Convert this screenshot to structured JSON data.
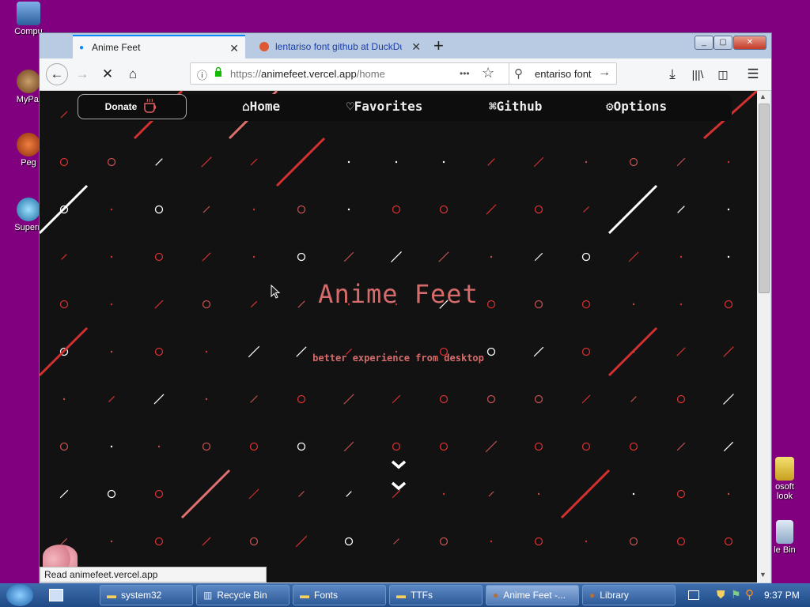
{
  "desktop": {
    "icons": [
      {
        "label": "Compu",
        "icon": "computer-icon"
      },
      {
        "label": "MyPal",
        "icon": "mypal-icon"
      },
      {
        "label": "Peg",
        "icon": "pegasus-icon"
      },
      {
        "label": "Supern",
        "icon": "supermium-icon"
      },
      {
        "label": "osoft\nlook",
        "icon": "outlook-icon"
      },
      {
        "label": "le Bin",
        "icon": "recycle-bin-icon"
      }
    ]
  },
  "browser": {
    "tabs": [
      {
        "title": "Anime Feet",
        "active": true
      },
      {
        "title": "lentariso font github at DuckDu",
        "active": false
      }
    ],
    "new_tab": "+",
    "url_protocol": "https://",
    "url_host": "animefeet.vercel.app",
    "url_path": "/home",
    "url_more": "•••",
    "search_value": "entariso font",
    "status_text": "Read animefeet.vercel.app"
  },
  "page": {
    "nav": {
      "donate": "Donate",
      "home": "Home",
      "favorites": "Favorites",
      "github": "Github",
      "options": "Options"
    },
    "title": "Anime Feet",
    "subtitle": "better experience from desktop"
  },
  "taskbar": {
    "items": [
      {
        "label": "system32",
        "icon": "folder-icon"
      },
      {
        "label": "Recycle Bin",
        "icon": "recycle-bin-icon"
      },
      {
        "label": "Fonts",
        "icon": "folder-icon"
      },
      {
        "label": "TTFs",
        "icon": "folder-icon"
      },
      {
        "label": "Anime Feet -...",
        "icon": "mypal-icon",
        "active": true
      },
      {
        "label": "Library",
        "icon": "mypal-icon"
      }
    ],
    "clock": "9:37 PM"
  },
  "colors": {
    "accent_red": "#d33030",
    "title_color": "#d66b6b",
    "desktop_bg": "#800080",
    "page_bg": "#121212"
  }
}
